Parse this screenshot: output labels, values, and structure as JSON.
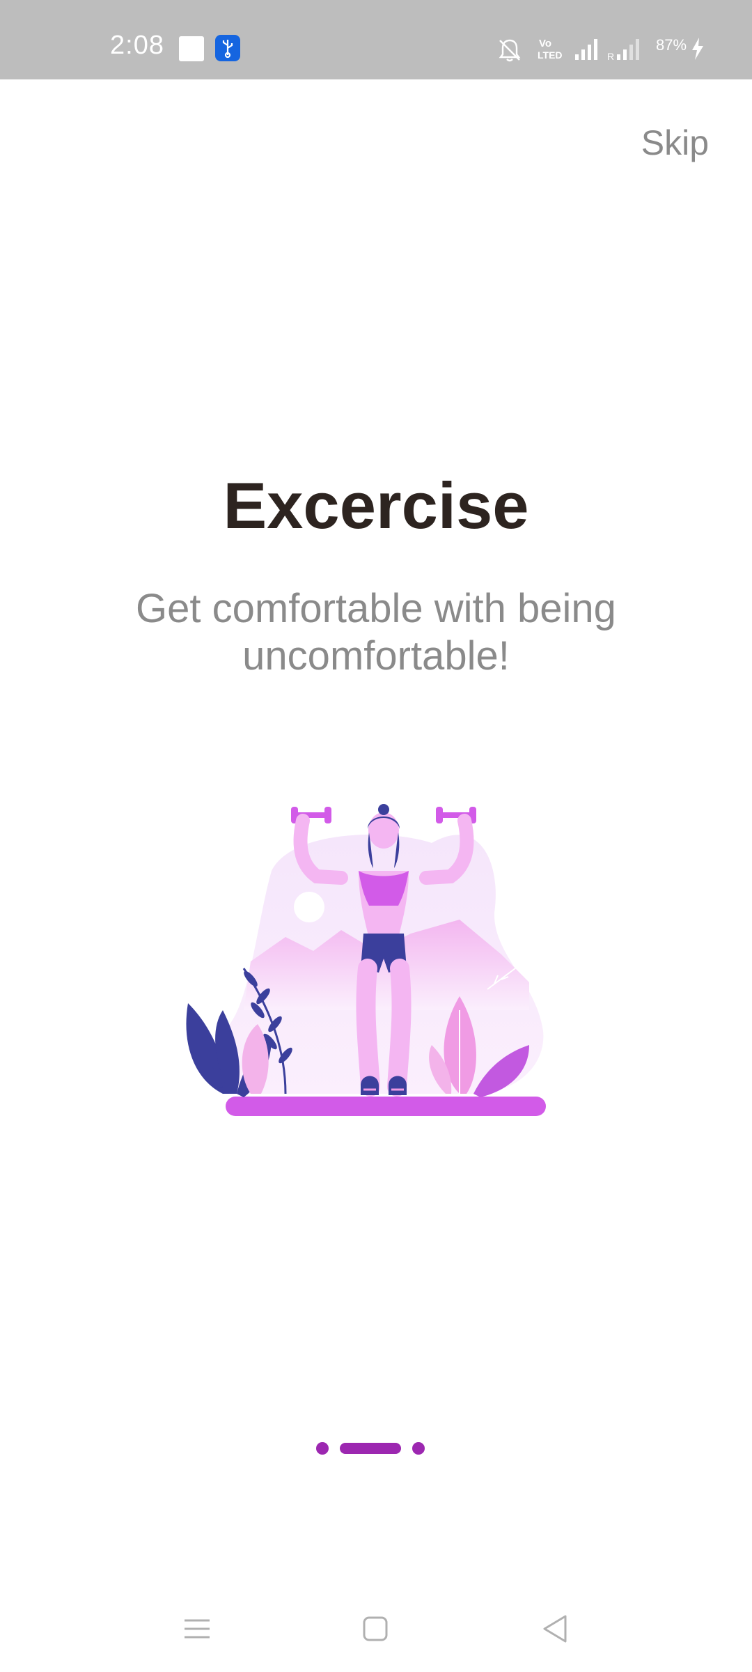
{
  "status_bar": {
    "time": "2:08",
    "battery": "87%",
    "background": "#bdbdbd"
  },
  "skip_label": "Skip",
  "title": "Excercise",
  "subtitle": "Get comfortable with being uncomfortable!",
  "page_indicator": {
    "total": 3,
    "active": 2,
    "color": "#9c27b0"
  },
  "illustration": "woman lifting dumbbells with plants",
  "navigation": {
    "menu_icon": "menu-icon",
    "home_icon": "home-icon",
    "back_icon": "back-icon"
  }
}
